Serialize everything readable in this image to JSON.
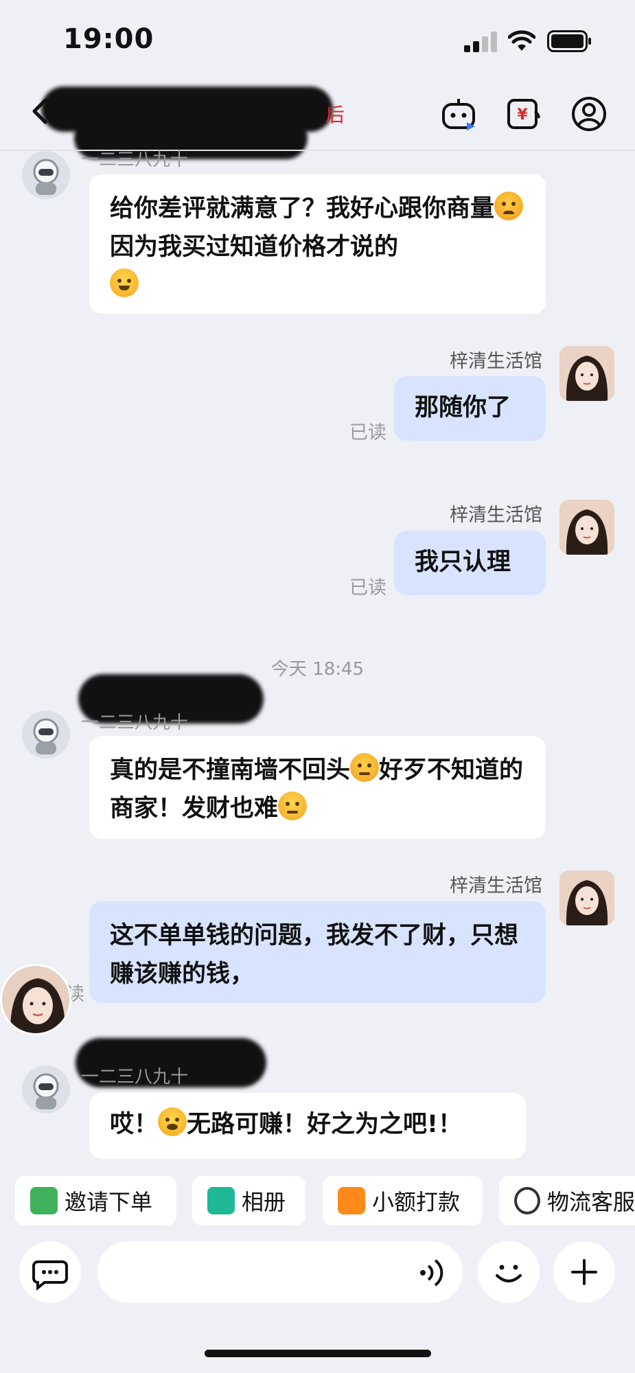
{
  "status_bar": {
    "time": "19:00"
  },
  "header": {
    "title_visible_fragment": "后"
  },
  "messages": [
    {
      "sender_blurred": "一二三八九十",
      "text_parts": [
        "给你差评就满意了？我好心跟你商量",
        "因为我买过知道价格才说的"
      ],
      "emojis": [
        "angry-face",
        "rofl-face"
      ]
    },
    {
      "sender": "梓清生活馆",
      "text": "那随你了",
      "read": "已读"
    },
    {
      "sender": "梓清生活馆",
      "text": "我只认理",
      "read": "已读"
    },
    {
      "sender_blurred": "一二三八九十",
      "text_parts": [
        "真的是不撞南墙不回头",
        "好歹不知道的商家！发财也难"
      ],
      "emojis": [
        "downcast-sweat-face",
        "holding-back-tears-face"
      ]
    },
    {
      "sender": "梓清生活馆",
      "text": "这不单单钱的问题，我发不了财，只想赚该赚的钱，",
      "read": "读"
    },
    {
      "sender_blurred": "一二三八九十",
      "text_parts": [
        "哎！",
        "无路可赚！好之为之吧!！"
      ],
      "emojis": [
        "yawning-face"
      ]
    }
  ],
  "timestamp": "今天 18:45",
  "quick_actions": [
    {
      "label": "邀请下单",
      "icon": "invite-order-icon",
      "color": "#3fb15b"
    },
    {
      "label": "相册",
      "icon": "album-icon",
      "color": "#1fb896"
    },
    {
      "label": "小额打款",
      "icon": "payment-icon",
      "color": "#ff8a1a"
    },
    {
      "label": "物流客服",
      "icon": "logistics-service-icon",
      "color": "#333333"
    }
  ],
  "input": {
    "placeholder": ""
  }
}
